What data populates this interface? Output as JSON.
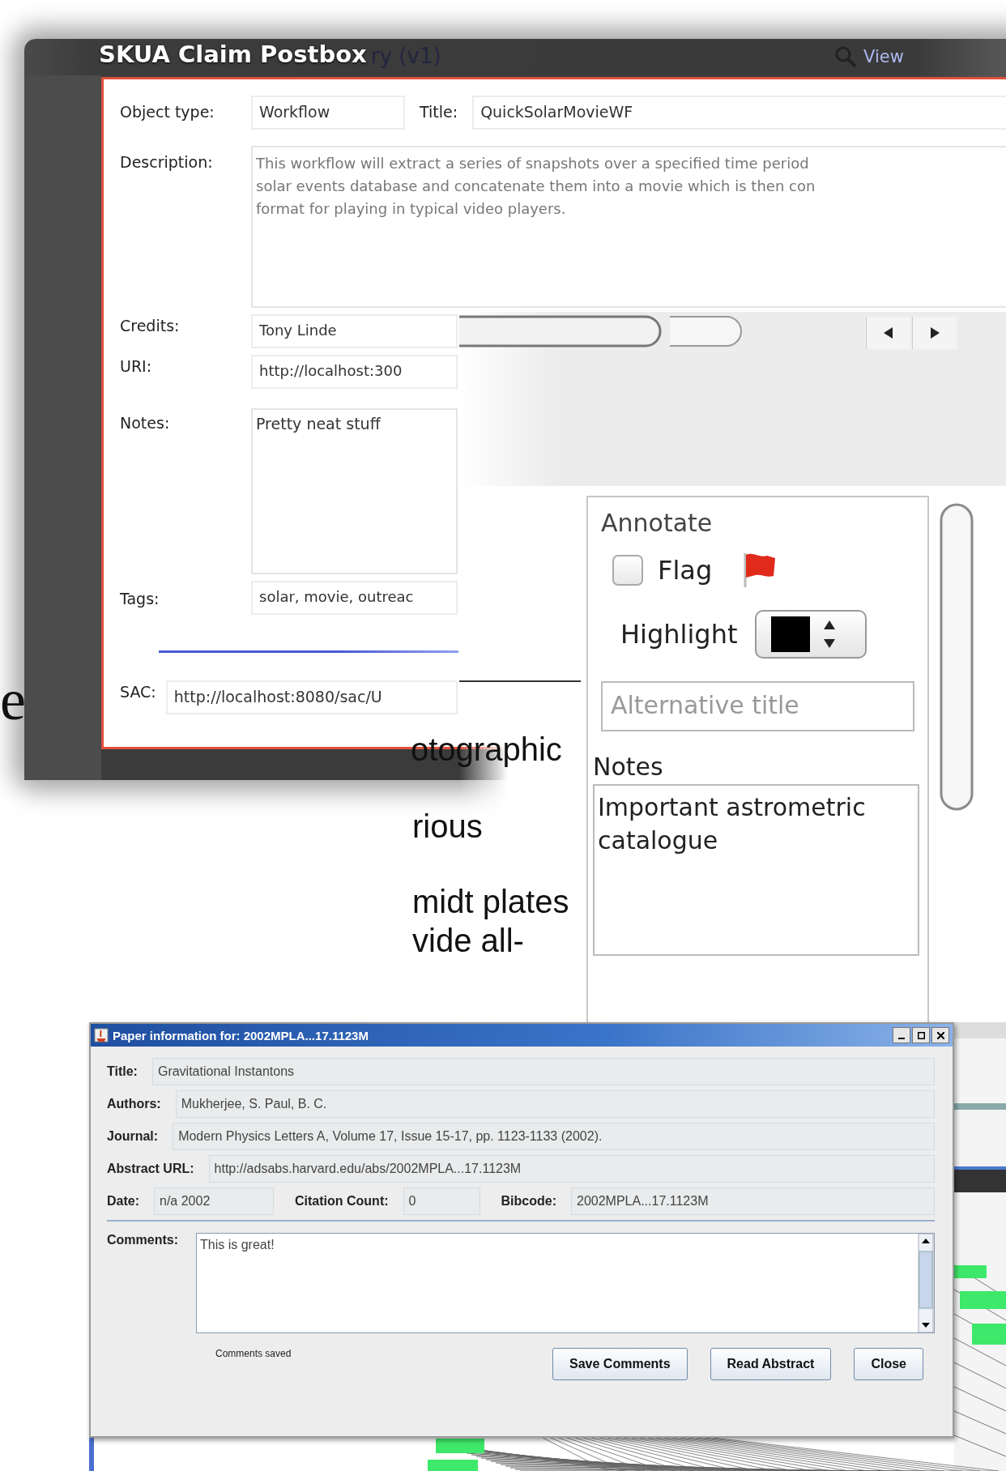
{
  "background": {
    "tab_text": "ry (v1)",
    "view_link": "View",
    "side_letter": "e",
    "fragments": [
      "otographic",
      "rious",
      "midt plates",
      "vide all-"
    ]
  },
  "claim_dialog": {
    "title": "SKUA Claim Postbox",
    "object_type": {
      "label": "Object type:",
      "value": "Workflow"
    },
    "title_field": {
      "label": "Title:",
      "value": "QuickSolarMovieWF"
    },
    "description": {
      "label": "Description:",
      "value": "This workflow will extract a series of snapshots over a specified time period\nsolar events database and concatenate them into a movie which is then con\nformat for playing in typical video players."
    },
    "credits": {
      "label": "Credits:",
      "value": "Tony Linde"
    },
    "uri": {
      "label": "URI:",
      "value": "http://localhost:300"
    },
    "notes": {
      "label": "Notes:",
      "value": "Pretty neat stuff"
    },
    "tags": {
      "label": "Tags:",
      "value": "solar, movie, outreac"
    },
    "sac": {
      "label": "SAC:",
      "value": "http://localhost:8080/sac/U"
    }
  },
  "annotate": {
    "heading": "Annotate",
    "flag": {
      "label": "Flag",
      "checked": false
    },
    "highlight": {
      "label": "Highlight",
      "color": "#000000"
    },
    "alternative_title": {
      "placeholder": "Alternative title"
    },
    "notes": {
      "label": "Notes",
      "value": "Important astrometric catalogue"
    }
  },
  "paper_dialog": {
    "title": "Paper information for: 2002MPLA...17.1123M",
    "rows": [
      [
        {
          "label": "Title:",
          "value": "Gravitational Instantons"
        }
      ],
      [
        {
          "label": "Authors:",
          "value": "Mukherjee, S. Paul, B. C."
        }
      ],
      [
        {
          "label": "Journal:",
          "value": "Modern Physics Letters A, Volume 17, Issue 15-17, pp. 1123-1133 (2002)."
        }
      ],
      [
        {
          "label": "Abstract URL:",
          "value": "http://adsabs.harvard.edu/abs/2002MPLA...17.1123M"
        }
      ],
      [
        {
          "label": "Date:",
          "value": "n/a 2002"
        },
        {
          "label": "Citation Count:",
          "value": "0"
        },
        {
          "label": "Bibcode:",
          "value": "2002MPLA...17.1123M"
        }
      ]
    ],
    "comments": {
      "label": "Comments:",
      "value": "This is great!"
    },
    "status": "Comments saved",
    "buttons": [
      "Save Comments",
      "Read Abstract",
      "Close"
    ]
  }
}
